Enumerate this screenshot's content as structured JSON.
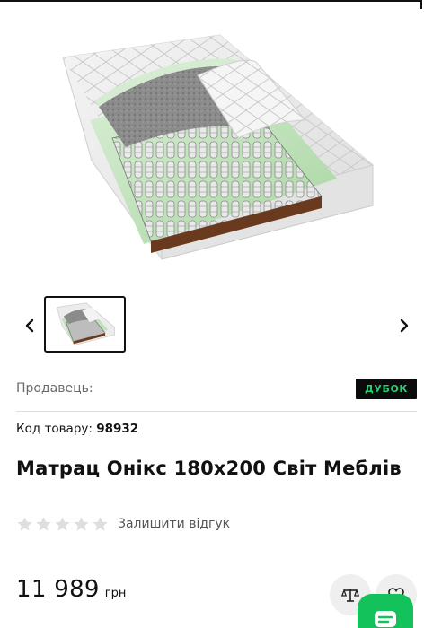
{
  "gallery": {
    "prev_icon": "chevron-left-icon",
    "next_icon": "chevron-right-icon",
    "thumbnail_count": 1
  },
  "seller": {
    "label": "Продавець:",
    "logo_text": "ДУБОК",
    "logo_bg": "#0b0b0b",
    "logo_color": "#21d170"
  },
  "product": {
    "code_label": "Код товару:",
    "code_value": "98932",
    "title": "Матрац Онікс 180х200 Світ Меблів",
    "rating": 0,
    "rating_max": 5,
    "review_link": "Залишити відгук",
    "price": "11 989",
    "currency": "грн"
  },
  "actions": {
    "compare_icon": "scales-icon",
    "favorite_icon": "heart-icon",
    "chat_icon": "chat-icon",
    "chat_color": "#14c25b"
  }
}
